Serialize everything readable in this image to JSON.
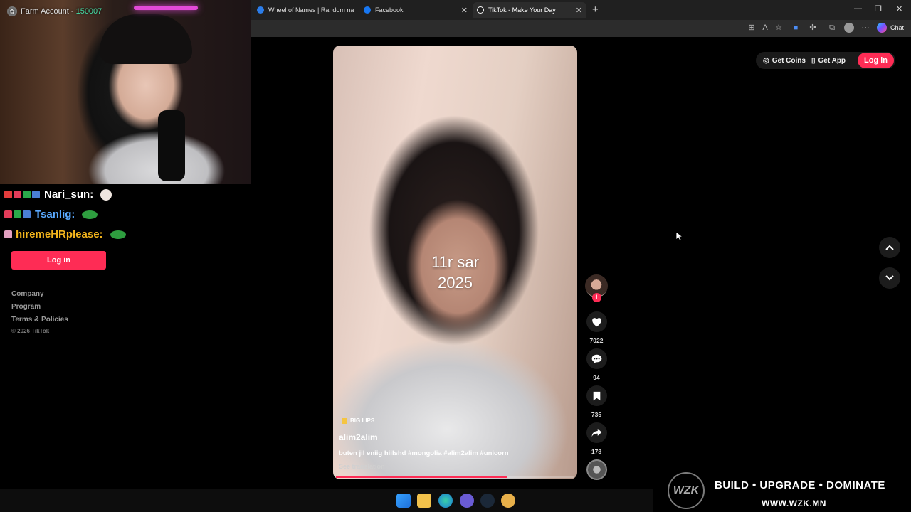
{
  "browser": {
    "tabs": [
      {
        "title": "Wheel of Names | Random name p",
        "favicon": "wheel-icon",
        "color": "#2b7de9"
      },
      {
        "title": "Facebook",
        "favicon": "facebook-icon",
        "color": "#1877f2"
      },
      {
        "title": "TikTok - Make Your Day",
        "favicon": "tiktok-icon",
        "color": "#ffffff"
      }
    ],
    "chat_label": "Chat"
  },
  "stream": {
    "account_label": "Farm Account - ",
    "account_points": "150007",
    "chat": [
      {
        "user": "Nari_sun:",
        "color": "#ffffff"
      },
      {
        "user": "Tsanlig:",
        "color": "#5aa9ff"
      },
      {
        "user": "hiremeHRplease:",
        "color": "#f2b41c"
      }
    ]
  },
  "tiktok": {
    "sidebar": {
      "login_label": "Log in",
      "links": [
        "Company",
        "Program",
        "Terms & Policies"
      ],
      "copyright": "© 2026 TikTok"
    },
    "header": {
      "get_coins": "Get Coins",
      "get_app": "Get App",
      "login": "Log in"
    },
    "video": {
      "overlay_line1": "11r sar",
      "overlay_line2": "2025",
      "tag": "BIG LIPS",
      "author": "alim2alim",
      "caption": "buten jil eniig hiilshd #mongolia #alim2alim #unicorn",
      "see_translation": "See translation",
      "progress": 0.72
    },
    "rail": {
      "likes": "7022",
      "comments": "94",
      "saves": "735",
      "shares": "178"
    },
    "accent": "#fe2c55"
  },
  "watermark": {
    "logo": "WZK",
    "tagline": "BUILD • UPGRADE • DOMINATE",
    "url": "WWW.WZK.MN"
  }
}
